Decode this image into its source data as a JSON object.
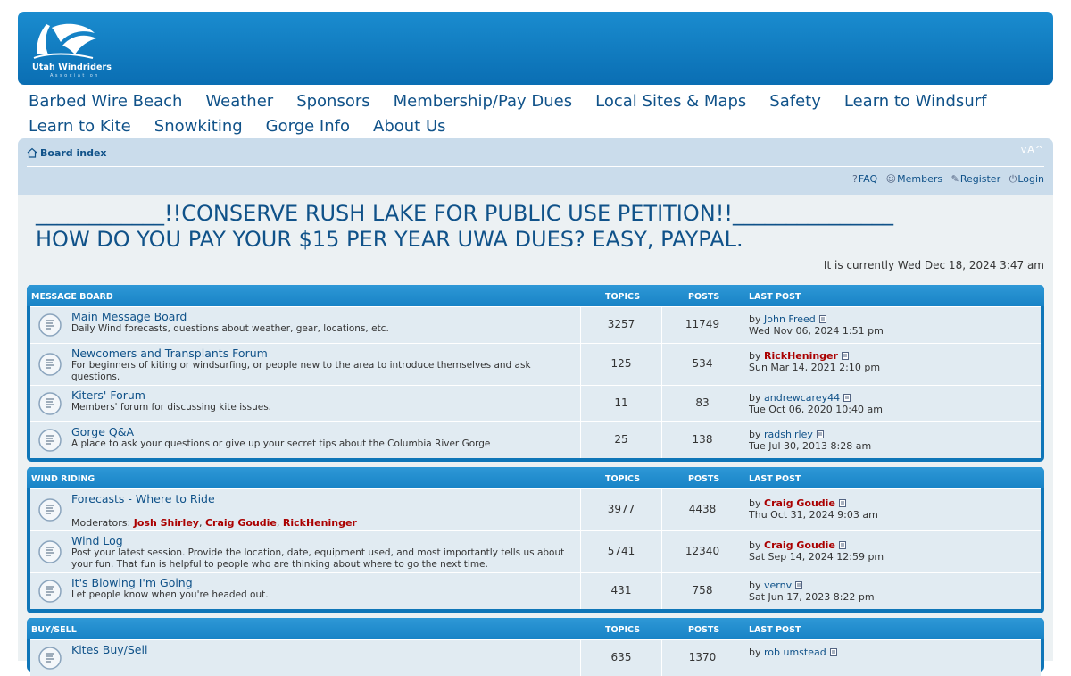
{
  "logo": {
    "name": "Utah Windriders",
    "sub": "Association"
  },
  "topnav": [
    "Barbed Wire Beach",
    "Weather",
    "Sponsors",
    "Membership/Pay Dues",
    "Local Sites & Maps",
    "Safety",
    "Learn to Windsurf",
    "Learn to Kite",
    "Snowkiting",
    "Gorge Info",
    "About Us"
  ],
  "breadcrumb": "Board index",
  "fontsize_ctrl": "vA^",
  "userlinks": {
    "faq": "FAQ",
    "members": "Members",
    "register": "Register",
    "login": "Login"
  },
  "announcements": [
    "____________!!CONSERVE RUSH LAKE FOR PUBLIC USE PETITION!!_______________",
    "HOW DO YOU PAY YOUR $15 PER YEAR UWA DUES? EASY, PAYPAL."
  ],
  "current_time": "It is currently Wed Dec 18, 2024 3:47 am",
  "columns": {
    "topics": "TOPICS",
    "posts": "POSTS",
    "last_post": "LAST POST"
  },
  "categories": [
    {
      "title": "MESSAGE BOARD",
      "forums": [
        {
          "title": "Main Message Board",
          "desc": "Daily Wind forecasts, questions about weather, gear, locations, etc.",
          "topics": "3257",
          "posts": "11749",
          "by": "by",
          "author": "John Freed",
          "date": "Wed Nov 06, 2024 1:51 pm"
        },
        {
          "title": "Newcomers and Transplants Forum",
          "desc": "For beginners of kiting or windsurfing, or people new to the area to introduce themselves and ask questions.",
          "topics": "125",
          "posts": "534",
          "by": "by",
          "author": "RickHeninger",
          "date": "Sun Mar 14, 2021 2:10 pm"
        },
        {
          "title": "Kiters' Forum",
          "desc": "Members' forum for discussing kite issues.",
          "topics": "11",
          "posts": "83",
          "by": "by",
          "author": "andrewcarey44",
          "date": "Tue Oct 06, 2020 10:40 am"
        },
        {
          "title": "Gorge Q&A",
          "desc": "A place to ask your questions or give up your secret tips about the Columbia River Gorge",
          "topics": "25",
          "posts": "138",
          "by": "by",
          "author": "radshirley",
          "date": "Tue Jul 30, 2013 8:28 am"
        }
      ]
    },
    {
      "title": "WIND RIDING",
      "forums": [
        {
          "title": "Forecasts - Where to Ride",
          "mods_label": "Moderators:",
          "mods": [
            "Josh Shirley",
            "Craig Goudie",
            "RickHeninger"
          ],
          "topics": "3977",
          "posts": "4438",
          "by": "by",
          "author": "Craig Goudie",
          "date": "Thu Oct 31, 2024 9:03 am"
        },
        {
          "title": "Wind Log",
          "desc": "Post your latest session. Provide the location, date, equipment used, and most importantly tells us about your fun. That fun is helpful to people who are thinking about where to go the next time.",
          "topics": "5741",
          "posts": "12340",
          "by": "by",
          "author": "Craig Goudie",
          "date": "Sat Sep 14, 2024 12:59 pm"
        },
        {
          "title": "It's Blowing I'm Going",
          "desc": "Let people know when you're headed out.",
          "topics": "431",
          "posts": "758",
          "by": "by",
          "author": "vernv",
          "date": "Sat Jun 17, 2023 8:22 pm"
        }
      ]
    },
    {
      "title": "BUY/SELL",
      "forums": [
        {
          "title": "Kites Buy/Sell",
          "topics": "635",
          "posts": "1370",
          "by": "by",
          "author": "rob umstead"
        }
      ]
    }
  ],
  "colors": {
    "header": "#0a6eb3",
    "link": "#105289",
    "moderator": "#aa0000",
    "row": "#e1ebf2",
    "category": "#1883c6"
  }
}
